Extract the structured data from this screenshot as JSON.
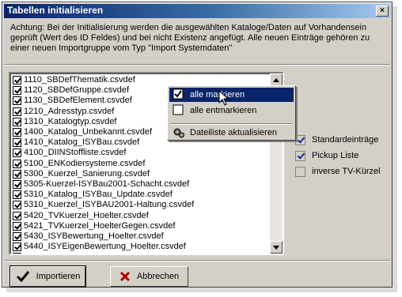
{
  "window": {
    "title": "Tabellen initialisieren",
    "close_symbol": "×"
  },
  "notice": "Achtung: Bei der Initialisierung werden die ausgewählten Kataloge/Daten auf Vorhandensein geprüft (Wert des ID Feldes) und bei nicht Existenz angefügt. Alle neuen Einträge gehören zu einer neuen Importgruppe vom Typ \"Import Systemdaten\"",
  "list": {
    "items": [
      {
        "label": "1110_SBDefThematik.csvdef",
        "checked": true
      },
      {
        "label": "1120_SBDefGruppe.csvdef",
        "checked": true
      },
      {
        "label": "1130_SBDefElement.csvdef",
        "checked": true
      },
      {
        "label": "1210_Adresstyp.csvdef",
        "checked": true
      },
      {
        "label": "1310_Katalogtyp.csvdef",
        "checked": true
      },
      {
        "label": "1400_Katalog_Unbekannt.csvdef",
        "checked": true
      },
      {
        "label": "1410_Katalog_ISYBau.csvdef",
        "checked": true
      },
      {
        "label": "4100_DIINStoffliste.csvdef",
        "checked": true
      },
      {
        "label": "5100_ENKodiersysteme.csvdef",
        "checked": true
      },
      {
        "label": "5300_Kuerzel_Sanierung.csvdef",
        "checked": true
      },
      {
        "label": "5305-Kuerzel-ISYBau2001-Schacht.csvdef",
        "checked": true
      },
      {
        "label": "5310_Katalog_ISYBau_Update.csvdef",
        "checked": true
      },
      {
        "label": "5310_Kuerzel_ISYBAU2001-Haltung.csvdef",
        "checked": true
      },
      {
        "label": "5420_TVKuerzel_Hoelter.csvdef",
        "checked": true
      },
      {
        "label": "5421_TVKuerzel_HoelterGegen.csvdef",
        "checked": true
      },
      {
        "label": "5430_ISYBewertung_Hoelter.csvdef",
        "checked": true
      },
      {
        "label": "5440_ISYEigenBewertung_Hoelter.csvdef",
        "checked": true
      },
      {
        "label": "",
        "checked": true
      }
    ]
  },
  "context_menu": {
    "mark_all": "alle markieren",
    "unmark_all": "alle entmarkieren",
    "refresh": "Dateiliste aktualisieren"
  },
  "options": [
    {
      "label": "Standardeinträge",
      "checked": true
    },
    {
      "label": "Pickup Liste",
      "checked": true
    },
    {
      "label": "inverse TV-Kürzel",
      "checked": false
    }
  ],
  "buttons": {
    "import": "Importieren",
    "cancel": "Abbrechen"
  },
  "colors": {
    "titlebar": "#0a246a",
    "highlight": "#0a246a",
    "face": "#d4d0c8"
  }
}
